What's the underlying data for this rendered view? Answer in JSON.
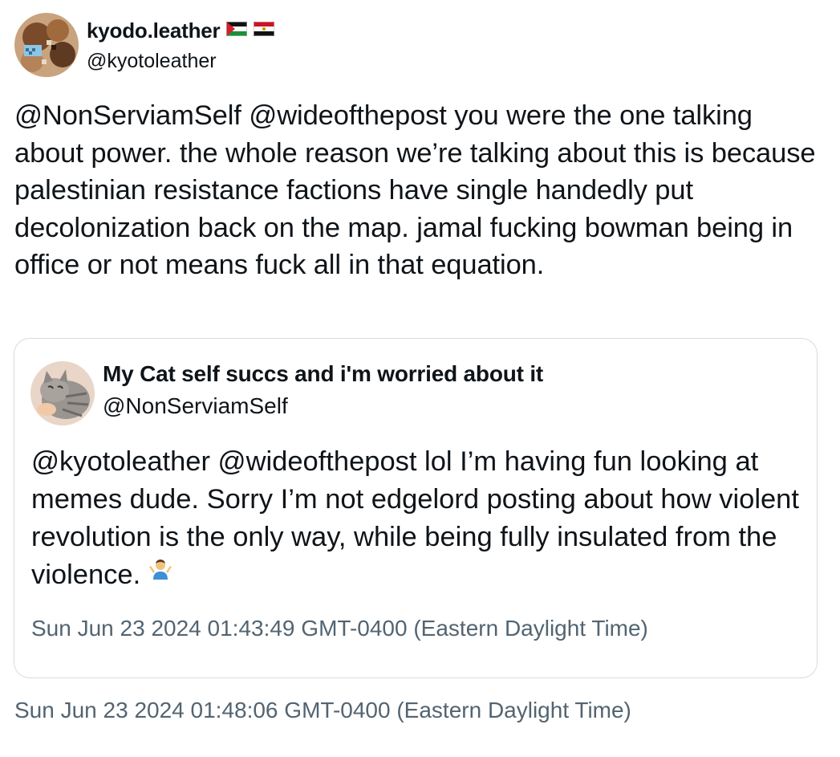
{
  "author": {
    "display_name": "kyodo.leather",
    "flags": [
      "palestine-flag-icon",
      "egypt-flag-icon"
    ],
    "handle": "@kyotoleather",
    "avatar": "avatar-image"
  },
  "tweet": {
    "text": "@NonServiamSelf @wideofthepost you were the one talking about power. the whole reason we’re talking about this is because palestinian resistance factions have single handedly put decolonization back on the map. jamal fucking bowman being in office or not means fuck all in that equation.",
    "timestamp": "Sun Jun 23 2024 01:48:06 GMT-0400 (Eastern Daylight Time)"
  },
  "quoted": {
    "display_name": "My Cat self succs and i'm worried about it",
    "handle": "@NonServiamSelf",
    "avatar": "cat-avatar-image",
    "text": "@kyotoleather @wideofthepost lol I’m having fun looking at memes dude. Sorry I’m not edgelord posting about how violent revolution is the only way, while being fully insulated from the violence.",
    "emoji": "person-shrugging-emoji",
    "timestamp": "Sun Jun 23 2024 01:43:49 GMT-0400 (Eastern Daylight Time)"
  },
  "colors": {
    "text": "#0f1419",
    "secondary_text": "#536471",
    "border": "#d6dbe0"
  }
}
